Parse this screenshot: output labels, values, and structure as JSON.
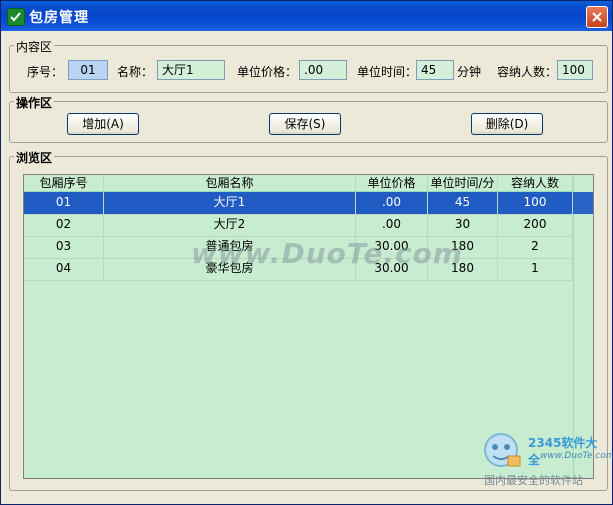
{
  "window": {
    "title": "包房管理",
    "close_label": "X"
  },
  "content_group": {
    "title": "内容区",
    "seq_label": "序号：",
    "seq_value": "01",
    "name_label": "名称：",
    "name_value": "大厅1",
    "price_label": "单位价格：",
    "price_value": ".00",
    "time_label": "单位时间：",
    "time_value": "45",
    "time_unit": "分钟",
    "capacity_label": "容纳人数：",
    "capacity_value": "100"
  },
  "operation_group": {
    "title": "操作区",
    "add_label": "增加(A)",
    "save_label": "保存(S)",
    "delete_label": "删除(D)"
  },
  "browse_group": {
    "title": "浏览区",
    "columns": [
      "包厢序号",
      "包厢名称",
      "单位价格",
      "单位时间/分",
      "容纳人数"
    ],
    "rows": [
      [
        "01",
        "大厅1",
        ".00",
        "45",
        "100"
      ],
      [
        "02",
        "大厅2",
        ".00",
        "30",
        "200"
      ],
      [
        "03",
        "普通包房",
        "30.00",
        "180",
        "2"
      ],
      [
        "04",
        "豪华包房",
        "30.00",
        "180",
        "1"
      ]
    ],
    "selected_row": 0
  },
  "watermark": {
    "text": "www.DuoTe.com",
    "logo_brand": "2345软件大全",
    "logo_url": "www.DuoTe.com",
    "logo_slogan": "国内最安全的软件站"
  },
  "colors": {
    "titlebar": "#0643c8",
    "grid_background": "#c8ecd0",
    "selection": "#1f5bc3",
    "field_green": "#d4f0d8",
    "field_blue": "#b9d3f3"
  }
}
